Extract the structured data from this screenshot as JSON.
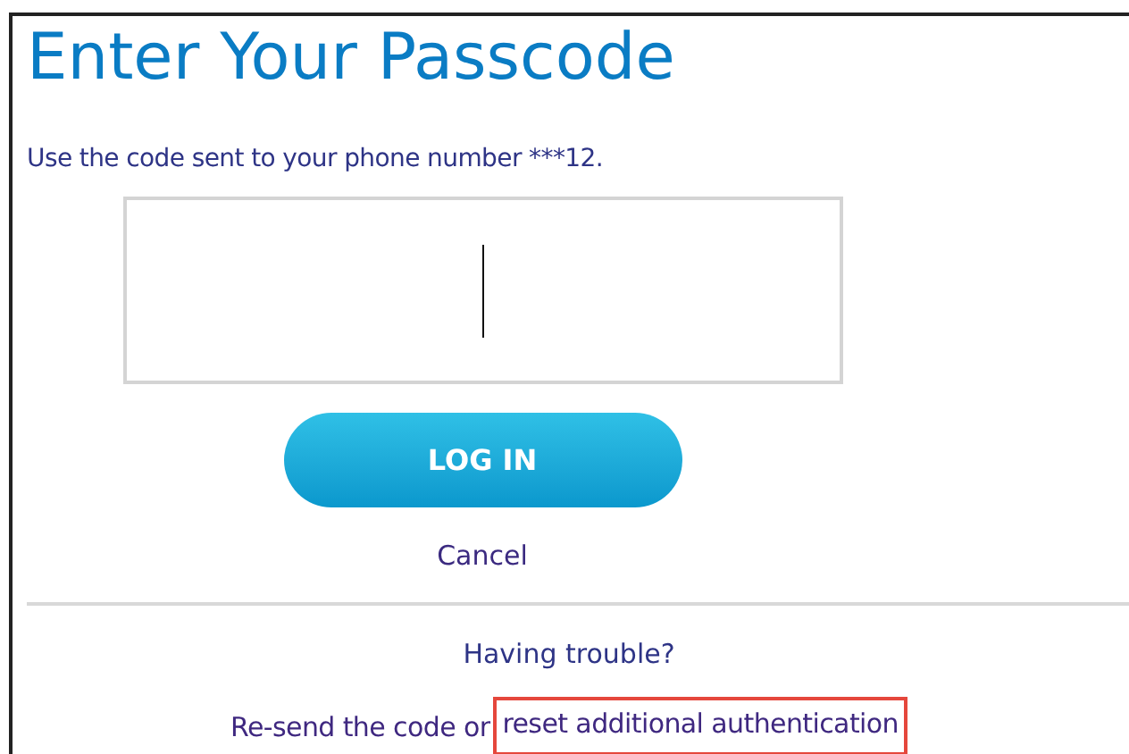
{
  "title": "Enter Your Passcode",
  "instruction": "Use the code sent to your phone number ***12.",
  "passcode_field": {
    "focused": true
  },
  "login_button": "LOG IN",
  "cancel_link": "Cancel",
  "trouble_heading": "Having trouble?",
  "resend_text": "Re-send the code or",
  "reset_link": {
    "label": "reset additional authentication",
    "highlighted": true
  }
}
